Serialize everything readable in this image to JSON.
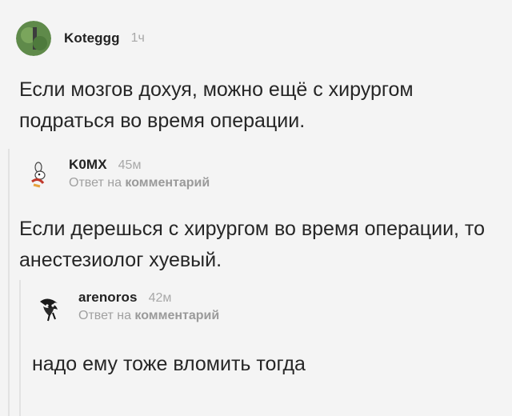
{
  "comments": [
    {
      "author": "Koteggg",
      "time": "1ч",
      "text": "Если мозгов дохуя, можно ещё с хирургом подраться во время операции."
    },
    {
      "author": "K0MX",
      "time": "45м",
      "reply_prefix": "Ответ на",
      "reply_target": "комментарий",
      "text": "Если дерешься с хирургом во время операции, то анестезиолог хуевый."
    },
    {
      "author": "arenoros",
      "time": "42м",
      "reply_prefix": "Ответ на",
      "reply_target": "комментарий",
      "text": "надо ему тоже вломить тогда"
    }
  ],
  "colors": {
    "background": "#f4f4f4",
    "text": "#262626",
    "muted": "#a8a8a8",
    "thread_line": "#e2e2e2"
  },
  "icons": [
    "green-avatar-icon",
    "cartoon-avatar-icon",
    "sketch-avatar-icon"
  ]
}
